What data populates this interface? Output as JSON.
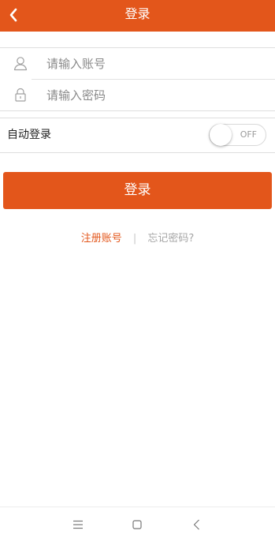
{
  "header": {
    "title": "登录",
    "back_icon": "chevron-left-icon"
  },
  "form": {
    "account_placeholder": "请输入账号",
    "account_icon": "user-icon",
    "password_placeholder": "请输入密码",
    "password_icon": "lock-icon"
  },
  "auto_login": {
    "label": "自动登录",
    "toggle_text": "OFF",
    "enabled": false
  },
  "login_button": {
    "label": "登录"
  },
  "links": {
    "register": "注册账号",
    "separator": "|",
    "forgot": "忘记密码?"
  },
  "system_nav": {
    "menu_icon": "menu-icon",
    "home_icon": "home-square-icon",
    "back_icon": "back-triangle-icon"
  },
  "colors": {
    "accent": "#e3561b",
    "link_gray": "#a6a6a6"
  }
}
